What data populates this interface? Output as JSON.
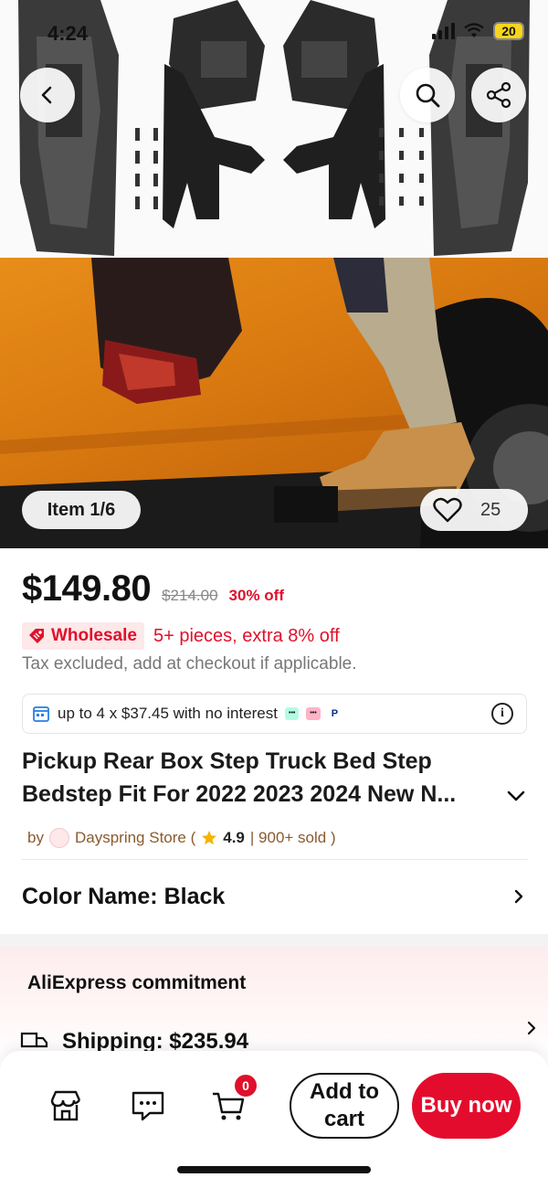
{
  "status_bar": {
    "time": "4:24",
    "battery": "20"
  },
  "gallery": {
    "item_counter": "Item 1/6",
    "favorites_count": "25"
  },
  "pricing": {
    "price": "$149.80",
    "original_price": "$214.00",
    "discount": "30% off",
    "wholesale_label": "Wholesale",
    "wholesale_offer": "5+ pieces, extra 8% off",
    "tax_note": "Tax excluded, add at checkout if applicable.",
    "installment": "up to 4 x $37.45 with no interest"
  },
  "product": {
    "title_line1": "Pickup Rear Box Step Truck Bed Step",
    "title_line2": "Bedstep Fit For 2022 2023 2024 New N..."
  },
  "store": {
    "by": "by",
    "name": "Dayspring Store (",
    "rating": "4.9",
    "sold": "| 900+ sold )"
  },
  "color": {
    "label": "Color Name: Black"
  },
  "commitment": {
    "title": "AliExpress commitment",
    "shipping": "Shipping: $235.94"
  },
  "bottom_bar": {
    "cart_count": "0",
    "add_to_cart": "Add to cart",
    "buy_now": "Buy now"
  },
  "colors": {
    "accent_red": "#e0102b",
    "buy_button": "#e40c2d",
    "store_brown": "#8a5a2e",
    "wholesale_bg": "#fde8ea"
  },
  "icons": [
    "back-arrow-icon",
    "search-icon",
    "share-icon",
    "heart-icon",
    "wholesale-tag-icon",
    "calendar-icon",
    "info-icon",
    "chevron-down-icon",
    "store-logo-icon",
    "star-icon",
    "chevron-right-icon",
    "truck-icon",
    "store-icon",
    "message-icon",
    "cart-icon"
  ]
}
